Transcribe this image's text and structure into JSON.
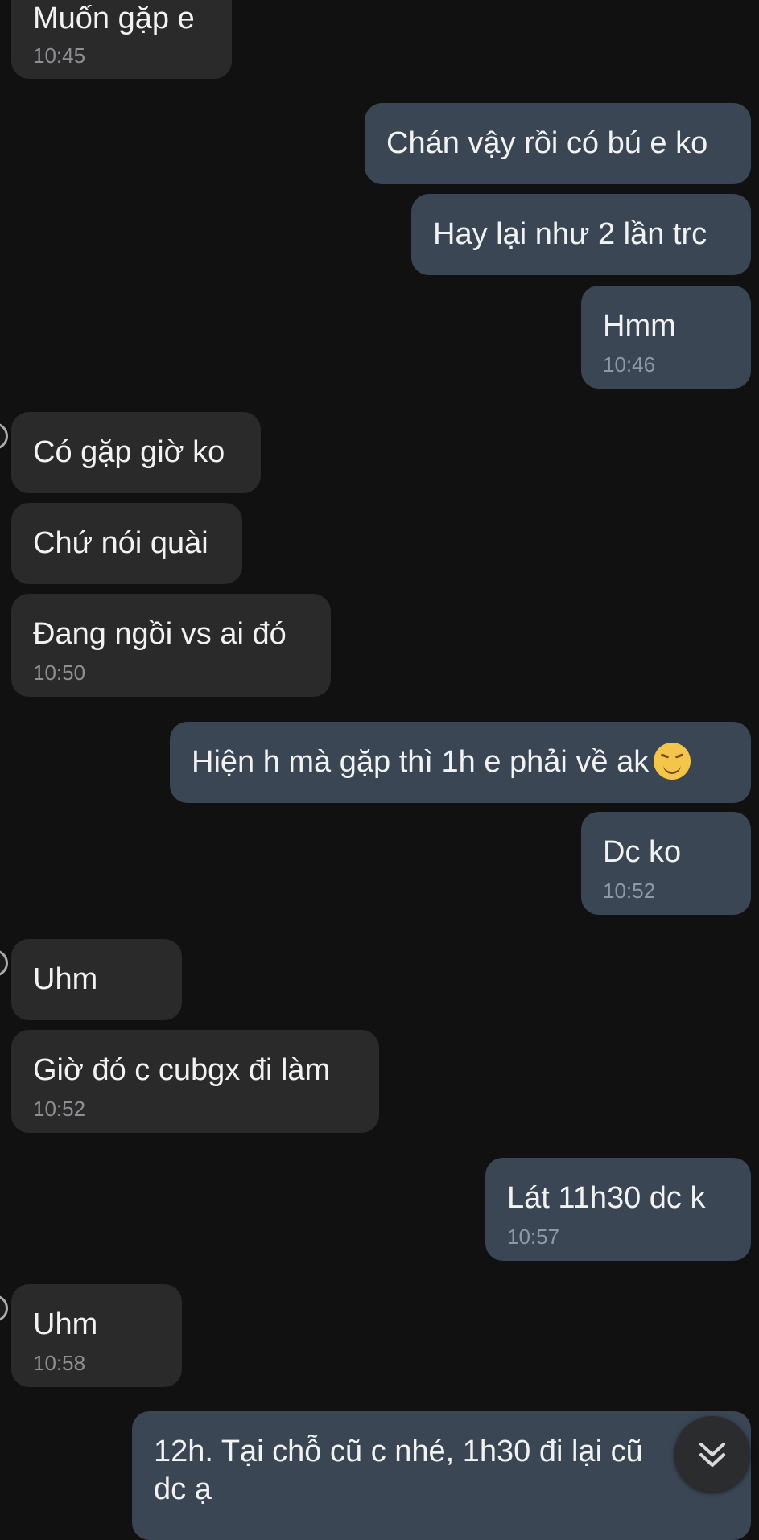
{
  "messages": [
    {
      "side": "in",
      "text": "Muốn gặp e",
      "time": "10:45"
    },
    {
      "side": "out",
      "text": "Chán vậy rồi có bú e ko"
    },
    {
      "side": "out",
      "text": "Hay lại như 2 lần trc"
    },
    {
      "side": "out",
      "text": "Hmm",
      "time": "10:46"
    },
    {
      "side": "in",
      "text": "Có gặp giờ ko"
    },
    {
      "side": "in",
      "text": "Chứ nói quài"
    },
    {
      "side": "in",
      "text": "Đang ngồi vs ai đó",
      "time": "10:50"
    },
    {
      "side": "out",
      "text": "Hiện h mà gặp thì 1h e phải về ak",
      "emoji": "grimace-emoji"
    },
    {
      "side": "out",
      "text": "Dc ko",
      "time": "10:52"
    },
    {
      "side": "in",
      "text": "Uhm"
    },
    {
      "side": "in",
      "text": "Giờ đó c cubgx đi làm",
      "time": "10:52"
    },
    {
      "side": "out",
      "text": "Lát 11h30 dc k",
      "time": "10:57"
    },
    {
      "side": "in",
      "text": "Uhm",
      "time": "10:58"
    },
    {
      "side": "out",
      "text": "12h. Tại chỗ cũ c nhé, 1h30 đi lại cũ",
      "text2": "dc ạ"
    }
  ],
  "scroll_button": {
    "icon": "double-chevron-down-icon"
  },
  "colors": {
    "background": "#111112",
    "incoming": "#2a2a2b",
    "outgoing": "#3b4655"
  }
}
